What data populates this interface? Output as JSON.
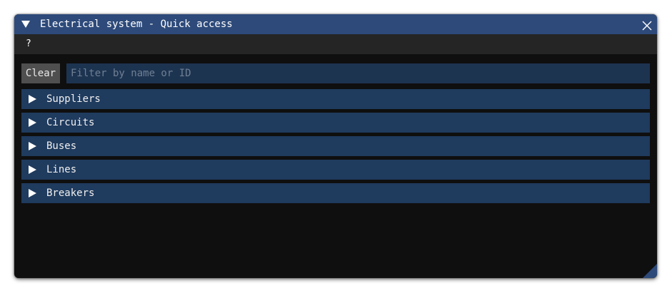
{
  "window": {
    "title": "Electrical system - Quick access"
  },
  "menu": {
    "help_label": "?"
  },
  "filter": {
    "clear_label": "Clear",
    "placeholder": "Filter by name or ID",
    "value": ""
  },
  "sections": [
    {
      "label": "Suppliers",
      "expanded": false
    },
    {
      "label": "Circuits",
      "expanded": false
    },
    {
      "label": "Buses",
      "expanded": false
    },
    {
      "label": "Lines",
      "expanded": false
    },
    {
      "label": "Breakers",
      "expanded": false
    }
  ],
  "colors": {
    "title_bar": "#2d4a7a",
    "menu_bar": "#252525",
    "window_bg": "#0f0f0f",
    "section_header": "#1f3b5e",
    "filter_bg": "#1d3451",
    "button_bg": "#4f4f4f"
  },
  "icons": {
    "collapse": "triangle-down-icon",
    "close": "close-icon",
    "section": "triangle-right-icon",
    "resize": "resize-grip-icon"
  }
}
